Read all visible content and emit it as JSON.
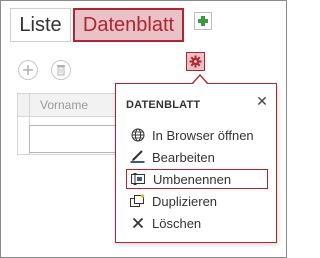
{
  "tabs": [
    {
      "label": "Liste"
    },
    {
      "label": "Datenblatt"
    }
  ],
  "grid": {
    "column_header": "Vorname"
  },
  "menu": {
    "title": "DATENBLATT",
    "close_glyph": "✕",
    "items": [
      {
        "label": "In Browser öffnen",
        "icon": "globe-icon"
      },
      {
        "label": "Bearbeiten",
        "icon": "edit-icon"
      },
      {
        "label": "Umbenennen",
        "icon": "rename-icon",
        "selected": true
      },
      {
        "label": "Duplizieren",
        "icon": "duplicate-icon"
      },
      {
        "label": "Löschen",
        "icon": "delete-icon"
      }
    ]
  },
  "colors": {
    "accent": "#b2242e",
    "accent_fill": "#e9c2c7",
    "add_green": "#3a9a44"
  }
}
